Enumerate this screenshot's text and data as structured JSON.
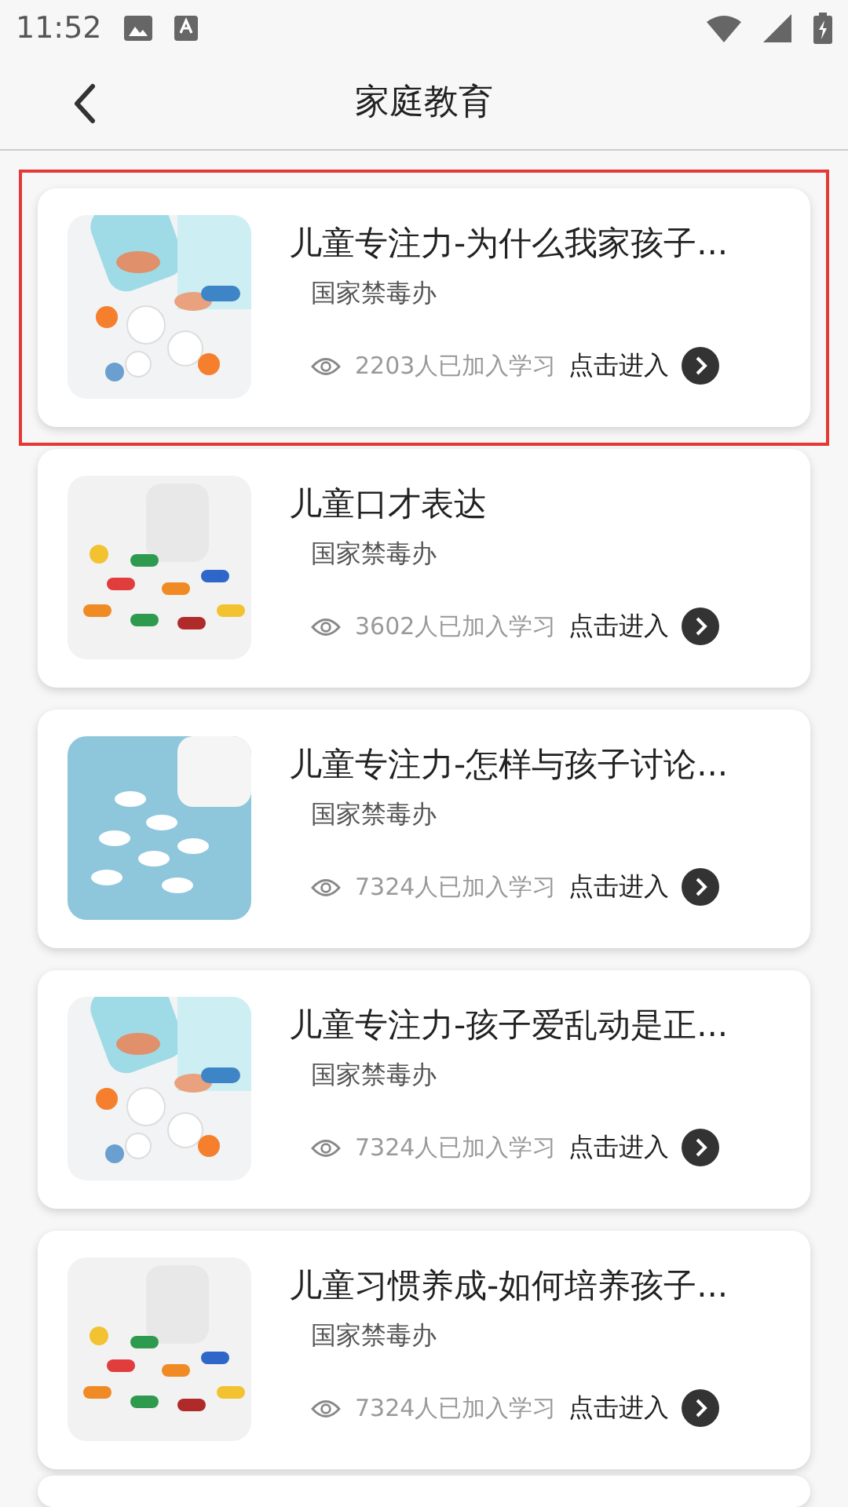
{
  "status_bar": {
    "time": "11:52"
  },
  "header": {
    "title": "家庭教育"
  },
  "courses": [
    {
      "title": "儿童专注力-为什么我家孩子...",
      "source": "国家禁毒办",
      "learners": "2203人已加入学习",
      "action": "点击进入",
      "selected": true,
      "kind": "capsules"
    },
    {
      "title": "儿童口才表达",
      "source": "国家禁毒办",
      "learners": "3602人已加入学习",
      "action": "点击进入",
      "selected": false,
      "kind": "colorful"
    },
    {
      "title": "儿童专注力-怎样与孩子讨论...",
      "source": "国家禁毒办",
      "learners": "7324人已加入学习",
      "action": "点击进入",
      "selected": false,
      "kind": "white"
    },
    {
      "title": "儿童专注力-孩子爱乱动是正...",
      "source": "国家禁毒办",
      "learners": "7324人已加入学习",
      "action": "点击进入",
      "selected": false,
      "kind": "capsules"
    },
    {
      "title": "儿童习惯养成-如何培养孩子...",
      "source": "国家禁毒办",
      "learners": "7324人已加入学习",
      "action": "点击进入",
      "selected": false,
      "kind": "colorful"
    }
  ]
}
